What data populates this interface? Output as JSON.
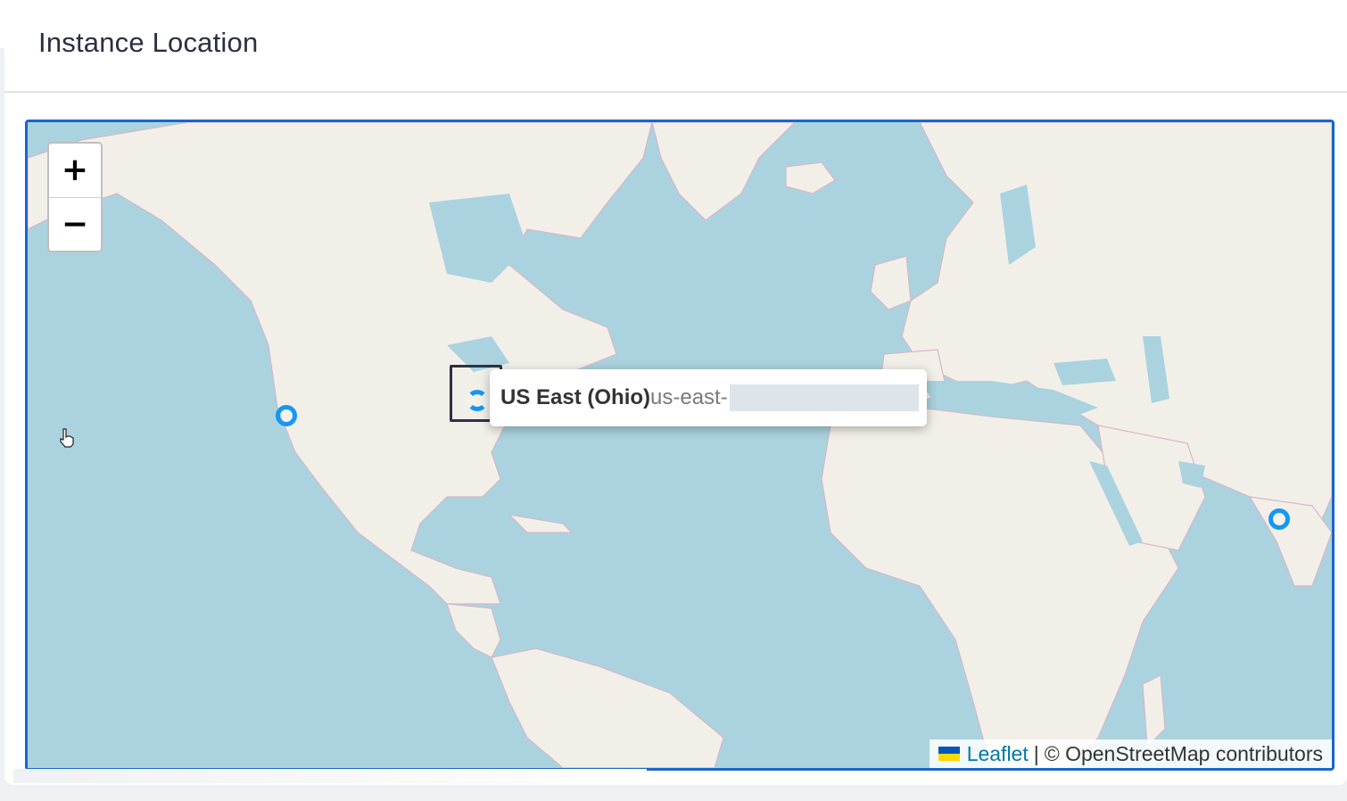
{
  "panel": {
    "title": "Instance Location"
  },
  "map": {
    "zoom_in_label": "+",
    "zoom_out_label": "−",
    "colors": {
      "water": "#aad3df",
      "land": "#f2efe9",
      "marker": "#1597f5",
      "frame": "#1a66c9"
    },
    "markers": [
      {
        "id": "us-west",
        "icon": "circle-marker",
        "state": "default"
      },
      {
        "id": "us-east-ohio",
        "icon": "circle-marker",
        "state": "loading"
      },
      {
        "id": "ap-south",
        "icon": "circle-marker",
        "state": "default"
      }
    ],
    "tooltip": {
      "name": "US East (Ohio)",
      "code_prefix": "us-east-"
    },
    "attribution": {
      "leaflet_label": "Leaflet",
      "separator": "|",
      "osm_text": "© OpenStreetMap contributors"
    }
  }
}
